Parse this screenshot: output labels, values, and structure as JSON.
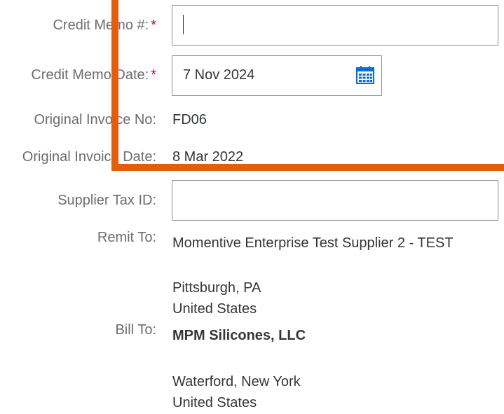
{
  "form": {
    "credit_memo_number": {
      "label": "Credit Memo #:",
      "required_mark": "*",
      "value": ""
    },
    "credit_memo_date": {
      "label": "Credit Memo Date:",
      "required_mark": "*",
      "value": "7 Nov 2024",
      "icon": "calendar-icon"
    },
    "original_invoice_no": {
      "label": "Original Invoice No:",
      "value": "FD06"
    },
    "original_invoice_date": {
      "label": "Original Invoice Date:",
      "value": "8 Mar 2022"
    },
    "supplier_tax_id": {
      "label": "Supplier Tax ID:",
      "value": ""
    },
    "remit_to": {
      "label": "Remit To:",
      "name": "Momentive Enterprise Test Supplier 2 - TEST",
      "city_state": "Pittsburgh, PA",
      "country": "United States"
    },
    "bill_to": {
      "label": "Bill To:",
      "name": "MPM Silicones, LLC",
      "city_state": "Waterford, New York",
      "country": "United States"
    }
  },
  "colors": {
    "highlight": "#e45d0f",
    "required": "#bb0066",
    "label": "#6a6d70",
    "value": "#32363a",
    "calendar": "#0a6ed1"
  }
}
